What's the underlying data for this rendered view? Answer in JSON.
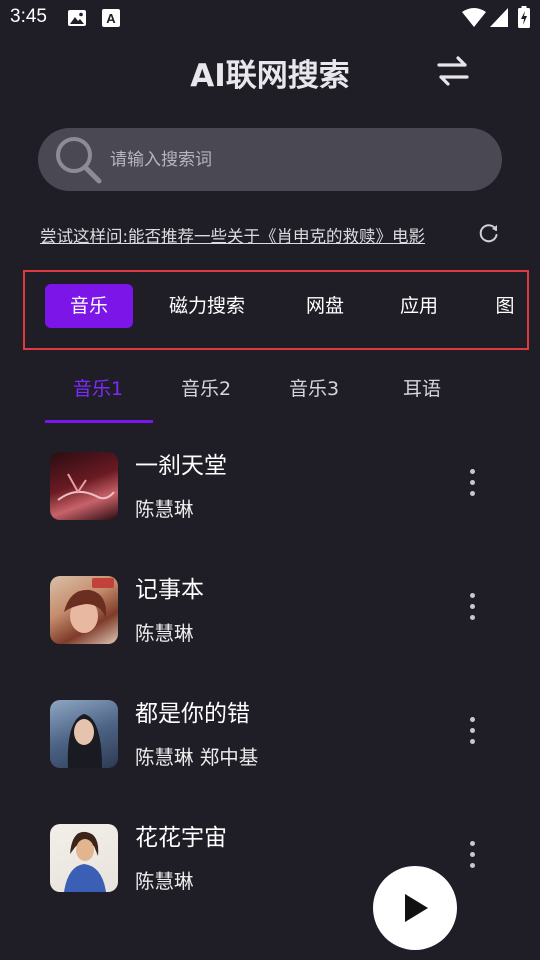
{
  "status_bar": {
    "time": "3:45",
    "left_icons": [
      "image-icon",
      "text-a-icon"
    ],
    "right_icons": [
      "wifi-icon",
      "signal-icon",
      "battery-charging-icon"
    ]
  },
  "header": {
    "title": "AI联网搜索",
    "action_icon": "swap-arrows-icon"
  },
  "search": {
    "placeholder": "请输入搜索词",
    "value": "",
    "icon": "search-icon"
  },
  "suggestion": {
    "text": "尝试这样问:能否推荐一些关于《肖申克的救赎》电影",
    "icon": "refresh-icon"
  },
  "categories": [
    {
      "label": "音乐",
      "active": true
    },
    {
      "label": "磁力搜索",
      "active": false
    },
    {
      "label": "网盘",
      "active": false
    },
    {
      "label": "应用",
      "active": false
    },
    {
      "label": "图",
      "active": false
    }
  ],
  "tabs": [
    {
      "label": "音乐1",
      "active": true
    },
    {
      "label": "音乐2",
      "active": false
    },
    {
      "label": "音乐3",
      "active": false
    },
    {
      "label": "耳语",
      "active": false
    }
  ],
  "songs": [
    {
      "title": "一刹天堂",
      "artist": "陈慧琳"
    },
    {
      "title": "记事本",
      "artist": "陈慧琳"
    },
    {
      "title": "都是你的错",
      "artist": "陈慧琳 郑中基"
    },
    {
      "title": "花花宇宙",
      "artist": "陈慧琳"
    }
  ],
  "colors": {
    "background": "#1f1d26",
    "accent": "#7c16e8",
    "highlight_border": "#e0393f",
    "search_bg": "#4a4853"
  },
  "player": {
    "icon": "play-icon"
  }
}
